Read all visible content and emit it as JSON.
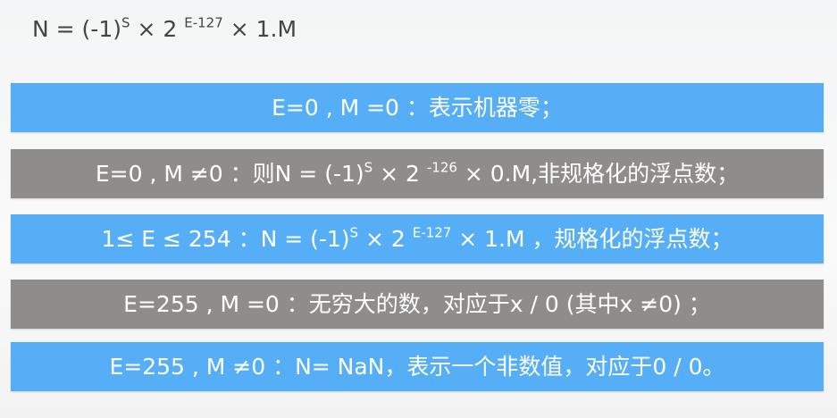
{
  "formula": {
    "a": "N = (-1)",
    "s": "S",
    "b": " × 2 ",
    "e": "E-127",
    "c": " × 1.M"
  },
  "rows": [
    {
      "color": "#56aff6",
      "a": "E=0 , M =0 ：表示机器零；"
    },
    {
      "color": "#8e8d8c",
      "a": "E=0 , M ≠0 ：则N = (-1)",
      "s": "S",
      "b": " × 2 ",
      "e": "-126",
      "c": " × 0.M,非规格化的浮点数；"
    },
    {
      "color": "#56aff6",
      "a": "1≤ E ≤ 254 ：N = (-1)",
      "s": "S",
      "b": " × 2 ",
      "e": "E-127",
      "c": " × 1.M ，规格化的浮点数；"
    },
    {
      "color": "#8e8d8c",
      "a": "E=255 , M =0 ：无穷大的数，对应于x / 0 (其中x ≠0) ；"
    },
    {
      "color": "#56aff6",
      "a": "E=255 , M ≠0 ：N= NaN，表示一个非数值，对应于0 / 0。"
    }
  ]
}
